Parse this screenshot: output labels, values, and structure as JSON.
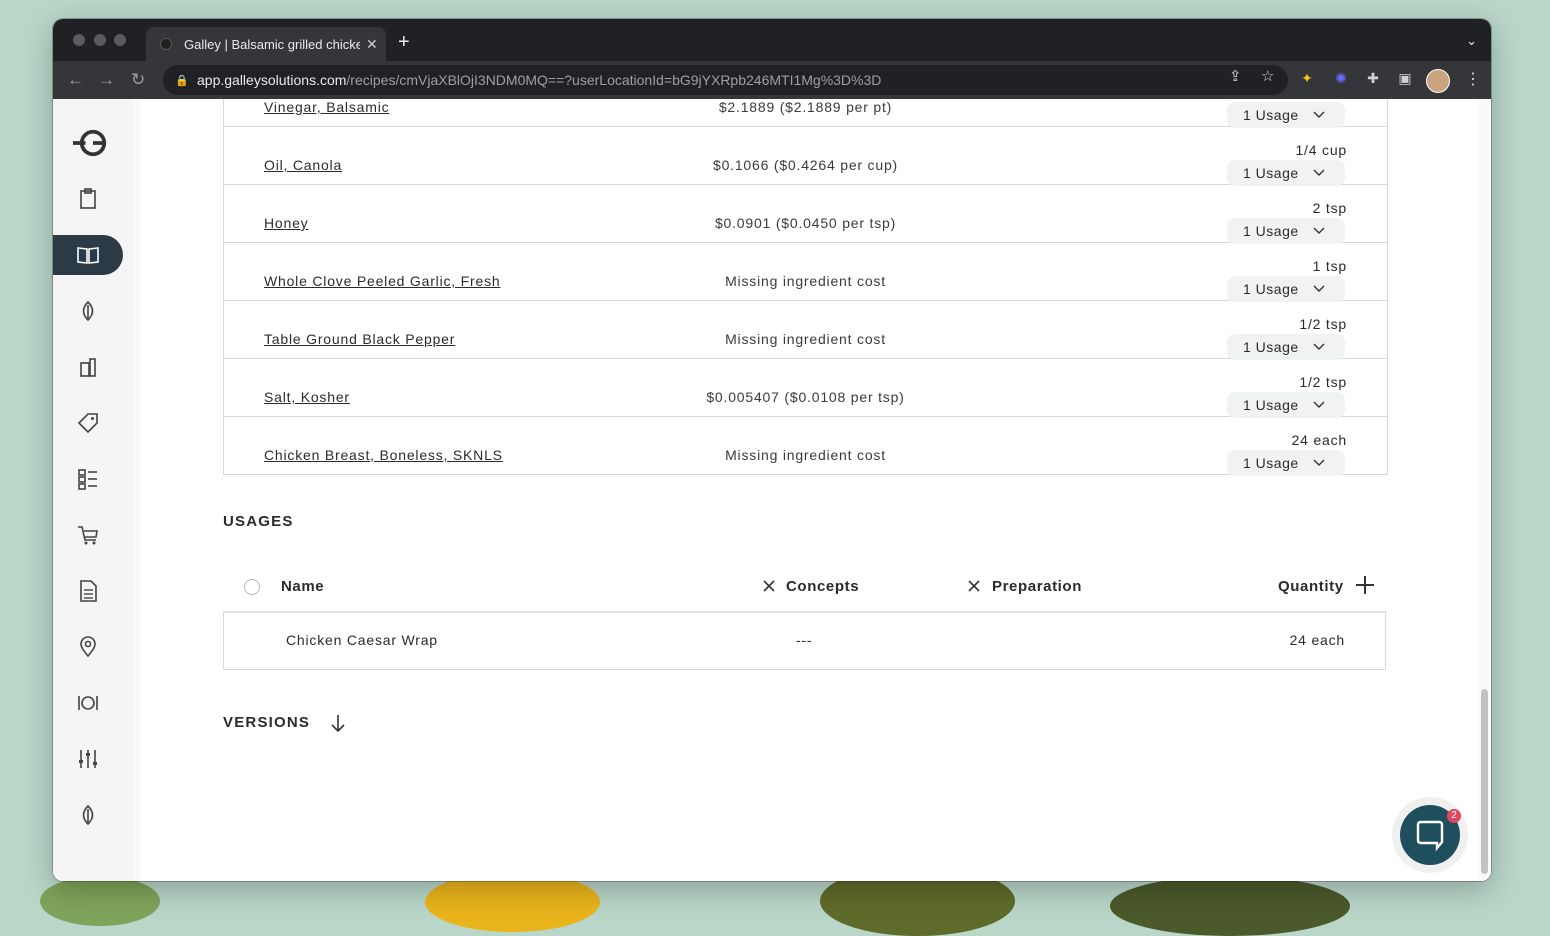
{
  "browser": {
    "tab_title": "Galley | Balsamic grilled chicke",
    "url_host": "app.galleysolutions.com",
    "url_path": "/recipes/cmVjaXBlOjI3NDM0MQ==?userLocationId=bG9jYXRpb246MTI1Mg%3D%3D"
  },
  "ingredients": [
    {
      "name": "Vinegar, Balsamic",
      "cost": "$2.1889 ($2.1889 per pt)",
      "qty": "",
      "usage": "1 Usage"
    },
    {
      "name": "Oil, Canola",
      "cost": "$0.1066 ($0.4264 per cup)",
      "qty": "1/4 cup",
      "usage": "1 Usage"
    },
    {
      "name": "Honey",
      "cost": "$0.0901 ($0.0450 per tsp)",
      "qty": "2 tsp",
      "usage": "1 Usage"
    },
    {
      "name": "Whole Clove Peeled Garlic, Fresh",
      "cost": "Missing ingredient cost",
      "qty": "1 tsp",
      "usage": "1 Usage"
    },
    {
      "name": "Table Ground Black Pepper",
      "cost": "Missing ingredient cost",
      "qty": "1/2 tsp",
      "usage": "1 Usage"
    },
    {
      "name": "Salt, Kosher",
      "cost": "$0.005407 ($0.0108 per tsp)",
      "qty": "1/2 tsp",
      "usage": "1 Usage"
    },
    {
      "name": "Chicken Breast, Boneless, SKNLS",
      "cost": "Missing ingredient cost",
      "qty": "24 each",
      "usage": "1 Usage"
    }
  ],
  "usages": {
    "title": "USAGES",
    "columns": {
      "name": "Name",
      "concepts": "Concepts",
      "preparation": "Preparation",
      "quantity": "Quantity"
    },
    "rows": [
      {
        "name": "Chicken Caesar Wrap",
        "concepts": "---",
        "quantity": "24 each"
      }
    ]
  },
  "versions": {
    "title": "VERSIONS"
  },
  "chat": {
    "badge": "2"
  },
  "colors": {
    "sidebar_active": "#2b3a45",
    "chat": "#1f4f5c",
    "badge": "#e0475f"
  }
}
